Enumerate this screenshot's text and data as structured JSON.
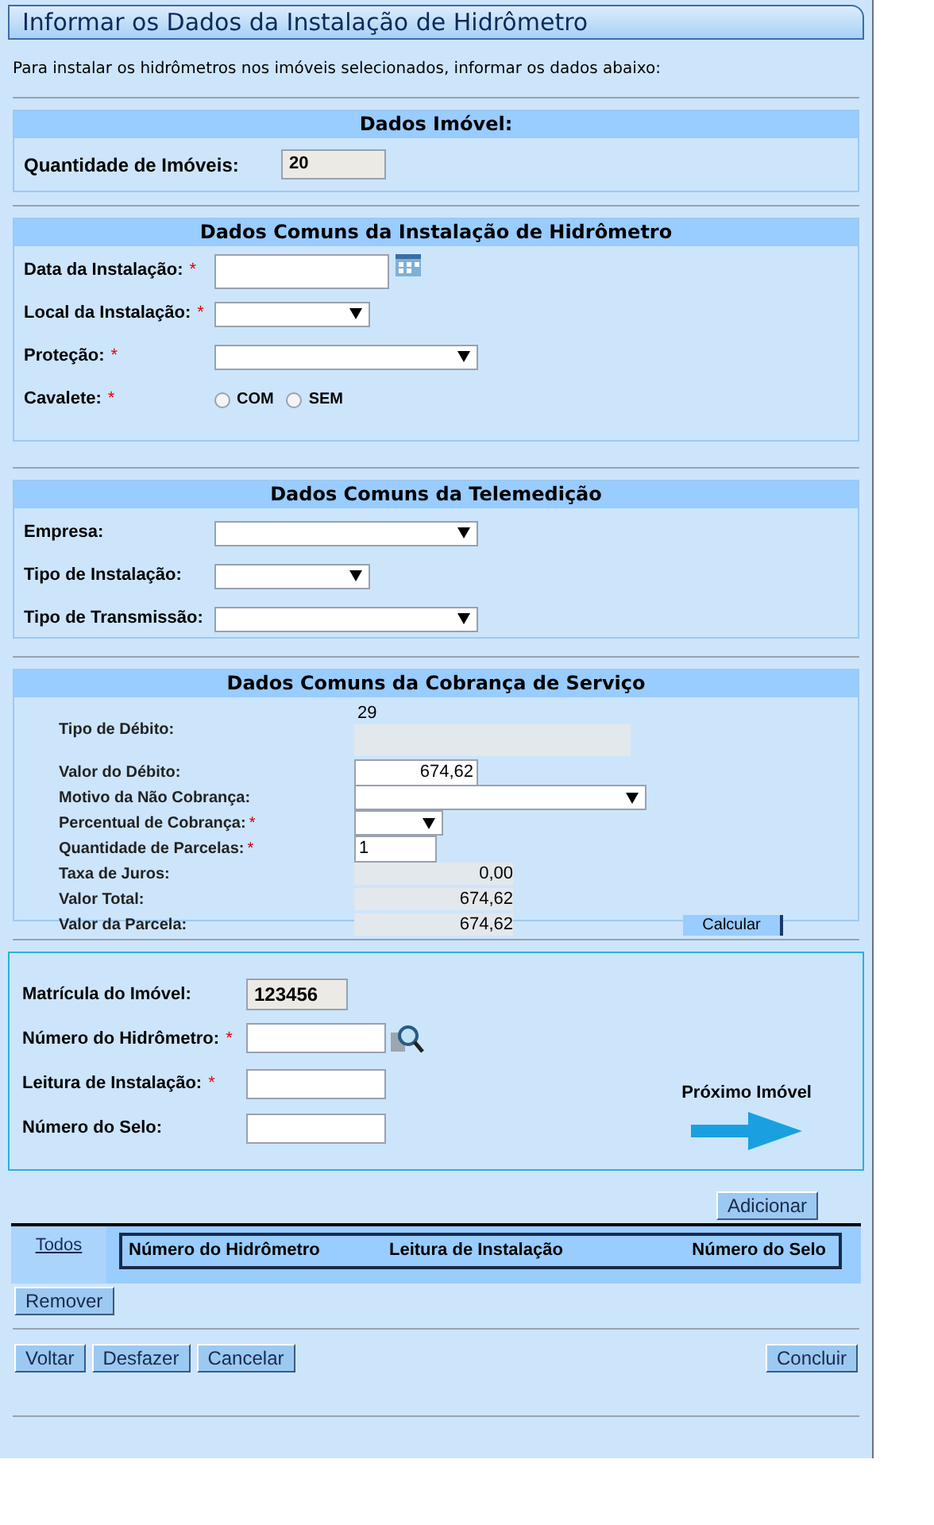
{
  "window": {
    "title": "Informar os Dados da Instalação de Hidrômetro"
  },
  "intro": "Para instalar os hidrômetros nos imóveis selecionados, informar os dados abaixo:",
  "imovel": {
    "title": "Dados Imóvel:",
    "label": "Quantidade de Imóveis:",
    "value": "20"
  },
  "instalacao": {
    "title": "Dados Comuns da Instalação de Hidrômetro",
    "fields": [
      {
        "kind": "date",
        "label": "Data da Instalação:",
        "required_mark": "*"
      },
      {
        "kind": "select",
        "label": "Local da Instalação:",
        "required_mark": "*"
      },
      {
        "kind": "select",
        "label": "Proteção:",
        "required_mark": "*"
      },
      {
        "kind": "radio",
        "label": "Cavalete:",
        "required_mark": "*",
        "options": [
          {
            "label": "COM",
            "selected": false
          },
          {
            "label": "SEM",
            "selected": false
          }
        ]
      }
    ]
  },
  "telemedicao": {
    "title": "Dados Comuns da Telemedição",
    "fields": [
      {
        "kind": "select",
        "label": "Empresa:"
      },
      {
        "kind": "select",
        "label": "Tipo de Instalação:"
      },
      {
        "kind": "select",
        "label": "Tipo de Transmissão:"
      }
    ]
  },
  "cobranca": {
    "title": "Dados Comuns da Cobrança de Serviço",
    "fields": [
      {
        "kind": "readonly-block",
        "label": "Tipo de Débito:",
        "value": "29"
      },
      {
        "kind": "input",
        "label": "Valor do Débito:",
        "value": "674,62"
      },
      {
        "kind": "select",
        "label": "Motivo da Não Cobrança:"
      },
      {
        "kind": "select",
        "label": "Percentual de Cobrança:",
        "required_mark": "*"
      },
      {
        "kind": "input",
        "label": "Quantidade de Parcelas:",
        "required_mark": "*",
        "value": "1"
      },
      {
        "kind": "readonly",
        "label": "Taxa de Juros:",
        "value": "0,00"
      },
      {
        "kind": "readonly",
        "label": "Valor Total:",
        "value": "674,62"
      },
      {
        "kind": "readonly",
        "label": "Valor da Parcela:",
        "value": "674,62"
      }
    ],
    "button": "Calcular"
  },
  "hidrometro": {
    "fields": [
      {
        "kind": "readonly",
        "label": "Matrícula do Imóvel:",
        "value": "123456"
      },
      {
        "kind": "search",
        "label": "Número do Hidrômetro:",
        "required_mark": "*"
      },
      {
        "kind": "input",
        "label": "Leitura de Instalação:",
        "required_mark": "*"
      },
      {
        "kind": "input",
        "label": "Número do Selo:"
      }
    ],
    "next": "Próximo Imóvel"
  },
  "add_button": "Adicionar",
  "table": {
    "select_all": "Todos",
    "columns": [
      "Número do Hidrômetro",
      "Leitura de Instalação",
      "Número do Selo"
    ]
  },
  "remove_button": "Remover",
  "buttons": [
    "Voltar",
    "Desfazer",
    "Cancelar"
  ],
  "submit_button": "Concluir"
}
